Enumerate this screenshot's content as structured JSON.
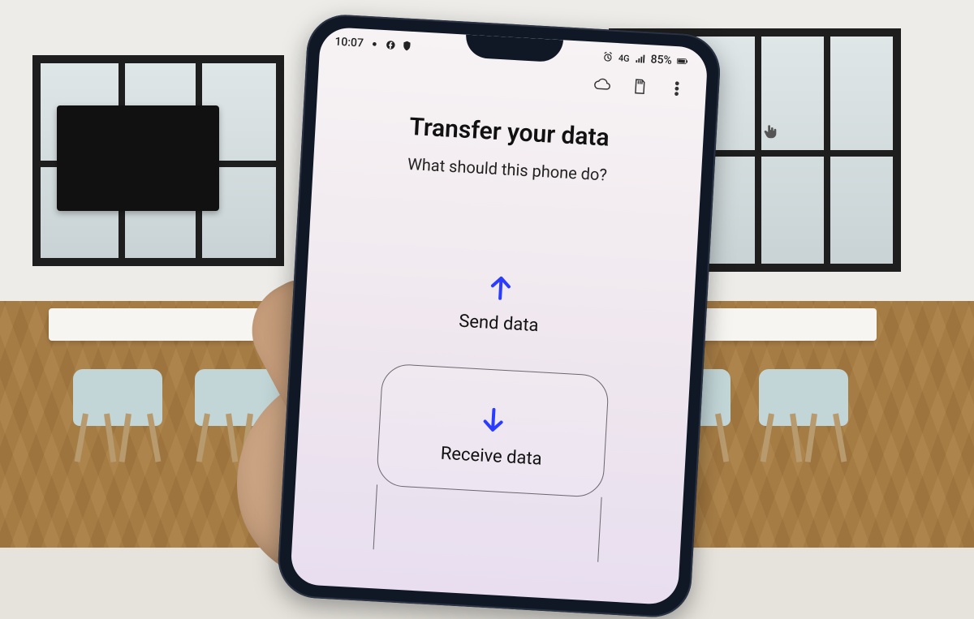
{
  "statusbar": {
    "time": "10:07",
    "network_label": "4G",
    "battery_text": "85%"
  },
  "appbar": {
    "cloud_icon": "cloud",
    "storage_icon": "sd-card",
    "overflow_icon": "more"
  },
  "screen": {
    "title": "Transfer your data",
    "subtitle": "What should this phone do?",
    "options": {
      "send": {
        "label": "Send data"
      },
      "receive": {
        "label": "Receive data"
      }
    }
  },
  "colors": {
    "accent": "#2a3cff"
  }
}
